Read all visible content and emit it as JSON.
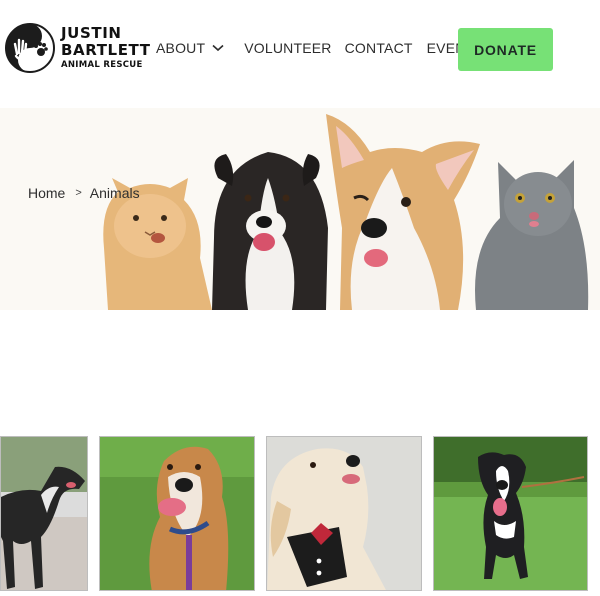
{
  "brand": {
    "line1": "JUSTIN",
    "line2": "BARTLETT",
    "line3": "ANIMAL RESCUE",
    "icon": "hand-paw-yin-yang-logo"
  },
  "nav": {
    "about": "ABOUT",
    "volunteer": "VOLUNTEER",
    "contact": "CONTACT",
    "events": "EVENTS",
    "donate": "DONATE"
  },
  "breadcrumb": {
    "home": "Home",
    "separator": ">",
    "current": "Animals"
  },
  "hero": {
    "image": "kitten-puppy-corgi-cat-photo"
  },
  "animals": [
    {
      "image": "black-greyhound-photo"
    },
    {
      "image": "tan-dog-on-grass-photo"
    },
    {
      "image": "white-dog-bowtie-photo"
    },
    {
      "image": "black-white-puppy-grass-photo"
    }
  ],
  "colors": {
    "donate_bg": "#77e176",
    "donate_text": "#1e2a25",
    "nav_text": "#2d2d2d",
    "hero_bg": "#fbf9f4"
  }
}
